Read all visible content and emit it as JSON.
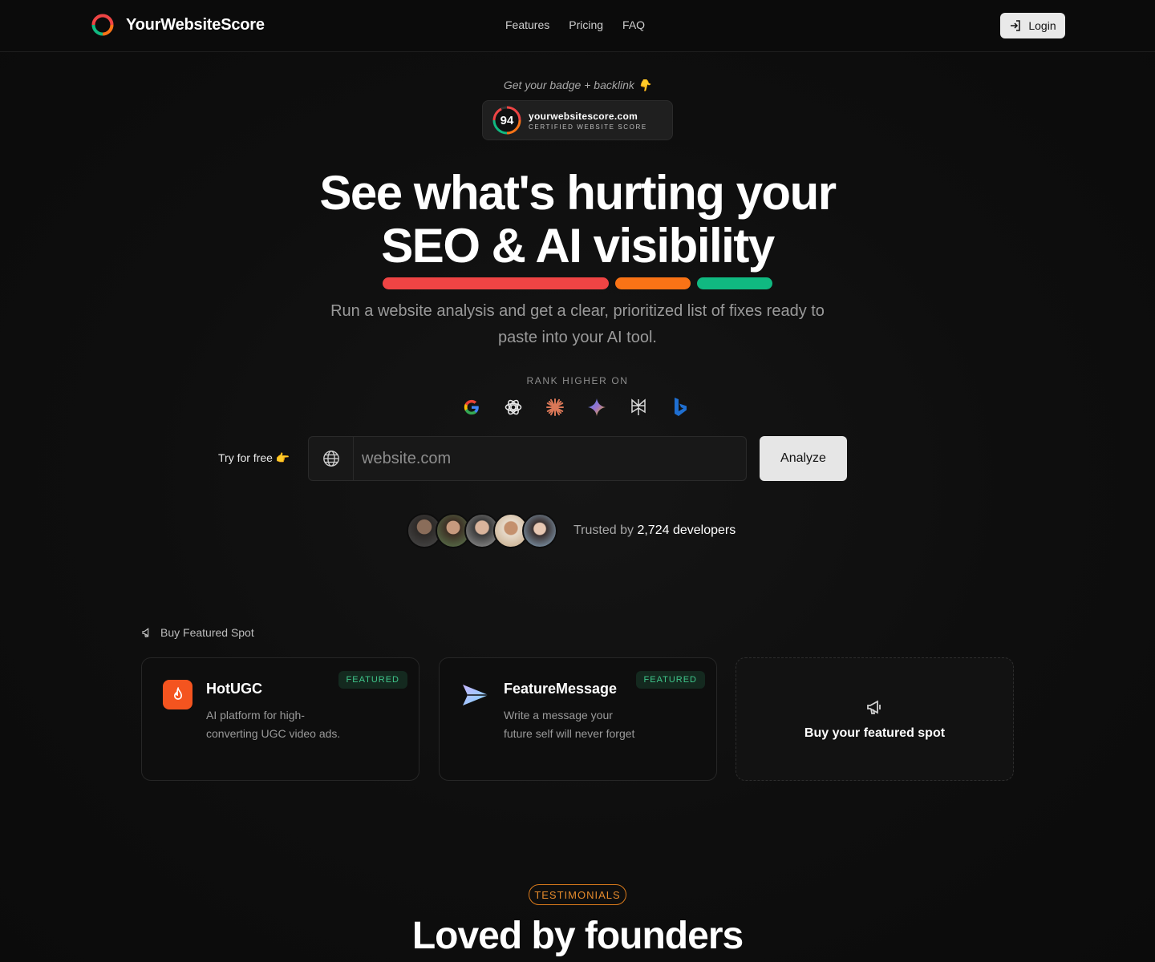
{
  "nav": {
    "brand": "YourWebsiteScore",
    "links": [
      "Features",
      "Pricing",
      "FAQ"
    ],
    "login": "Login"
  },
  "badge": {
    "caption": "Get your badge + backlink 👇",
    "score": "94",
    "domain": "yourwebsitescore.com",
    "subtitle": "CERTIFIED WEBSITE SCORE"
  },
  "hero": {
    "line1": "See what's hurting your",
    "line2": "SEO & AI visibility",
    "subtitle_line1": "Run a website analysis and get a clear, prioritized list of fixes ready to",
    "subtitle_line2": "paste into your AI tool.",
    "bar_colors": [
      "#ef4444",
      "#f97316",
      "#10b981"
    ]
  },
  "rank": {
    "label": "RANK HIGHER ON",
    "platform_icons": [
      "google-icon",
      "chatgpt-icon",
      "claude-icon",
      "gemini-icon",
      "perplexity-icon",
      "bing-icon"
    ]
  },
  "search": {
    "try_label": "Try for free 👉",
    "placeholder": "website.com",
    "button": "Analyze"
  },
  "social": {
    "trusted_prefix": "Trusted by",
    "count": "2,724 developers"
  },
  "featured": {
    "label": "Buy Featured Spot",
    "cards": [
      {
        "title": "HotUGC",
        "description": "AI platform for high-converting UGC video ads.",
        "tag": "FEATURED",
        "icon": "flame-icon"
      },
      {
        "title": "FeatureMessage",
        "description": "Write a message your future self will never forget",
        "tag": "FEATURED",
        "icon": "paper-plane-icon"
      }
    ],
    "buy_spot": "Buy your featured spot"
  },
  "testimonials": {
    "tag": "TESTIMONIALS",
    "heading": "Loved by founders"
  },
  "colors": {
    "accent_orange": "#f97316",
    "featured_green": "#3fc58a"
  }
}
